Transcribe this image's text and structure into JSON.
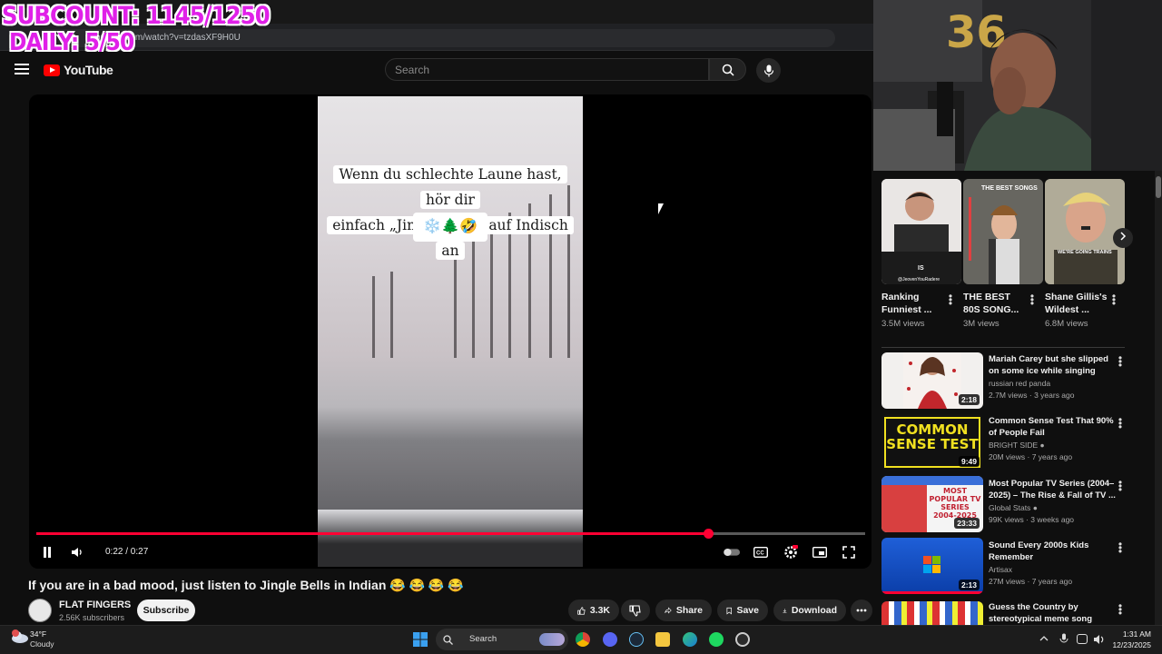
{
  "overlay": {
    "subcount": "SUBCOUNT: 1145/1250",
    "daily": "DAILY: 5/50"
  },
  "browser": {
    "url": "youtube.com/watch?v=tzdasXF9H0U"
  },
  "header": {
    "logo_text": "YouTube",
    "search_placeholder": "Search"
  },
  "player": {
    "caption_line1": "Wenn du schlechte Laune hast, hör dir",
    "caption_line2": "einfach „Jingle Bells“ auf Indisch an",
    "caption_emoji": "❄️🌲🤣",
    "time": "0:22 / 0:27",
    "progress": 0.81
  },
  "video": {
    "title": "If you are in a bad mood, just listen to Jingle Bells in Indian 😂 😂 😂 😂",
    "channel": "FLAT FINGERS",
    "subscribers": "2.56K subscribers",
    "subscribe_label": "Subscribe",
    "likes": "3.3K",
    "share_label": "Share",
    "save_label": "Save",
    "download_label": "Download"
  },
  "shorts": [
    {
      "title": "Ranking Funniest ...",
      "views": "3.5M views",
      "thumb_text": "IS",
      "thumb_sub": "@JeovenYouRadere"
    },
    {
      "title": "THE BEST 80S SONG...",
      "views": "3M views",
      "thumb_text": "THE BEST SONGS"
    },
    {
      "title": "Shane Gillis's Wildest ...",
      "views": "6.8M views",
      "thumb_text": "WE'RE GOING TRAINS"
    }
  ],
  "recommendations": [
    {
      "title": "Mariah Carey but she slipped on some ice while singing",
      "channel": "russian red panda",
      "meta": "2.7M views · 3 years ago",
      "duration": "2:18",
      "verified": false
    },
    {
      "title": "Common Sense Test That 90% of People Fail",
      "channel": "BRIGHT SIDE",
      "meta": "20M views · 7 years ago",
      "duration": "9:49",
      "verified": true,
      "thumb_text": "COMMON SENSE TEST"
    },
    {
      "title": "Most Popular TV Series (2004–2025) – The Rise & Fall of TV ...",
      "channel": "Global Stats",
      "meta": "99K views · 3 weeks ago",
      "duration": "23:33",
      "verified": true,
      "thumb_text": "MOST POPULAR TV SERIES 2004-2025"
    },
    {
      "title": "Sound Every 2000s Kids Remember",
      "channel": "Artisax",
      "meta": "27M views · 7 years ago",
      "duration": "2:13",
      "verified": false
    },
    {
      "title": "Guess the Country by stereotypical meme song",
      "channel": "",
      "meta": "",
      "duration": "",
      "verified": false
    }
  ],
  "taskbar": {
    "weather_temp": "34°F",
    "weather_desc": "Cloudy",
    "search_label": "Search",
    "time": "1:31 AM",
    "date": "12/23/2025"
  }
}
